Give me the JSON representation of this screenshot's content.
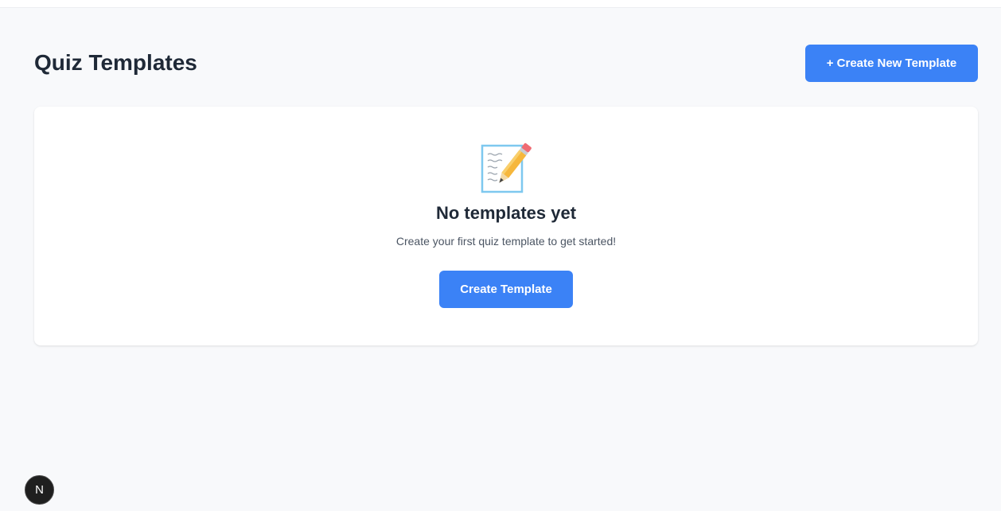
{
  "header": {
    "title": "Quiz Templates",
    "create_button_label": "+ Create New Template"
  },
  "empty_state": {
    "icon": "memo-pencil-icon",
    "title": "No templates yet",
    "description": "Create your first quiz template to get started!",
    "button_label": "Create Template"
  },
  "dev_badge": {
    "label": "N"
  },
  "colors": {
    "accent": "#3b82f6",
    "background": "#f8f9fb",
    "card": "#ffffff",
    "text_primary": "#1f2937",
    "text_secondary": "#4b5563"
  }
}
